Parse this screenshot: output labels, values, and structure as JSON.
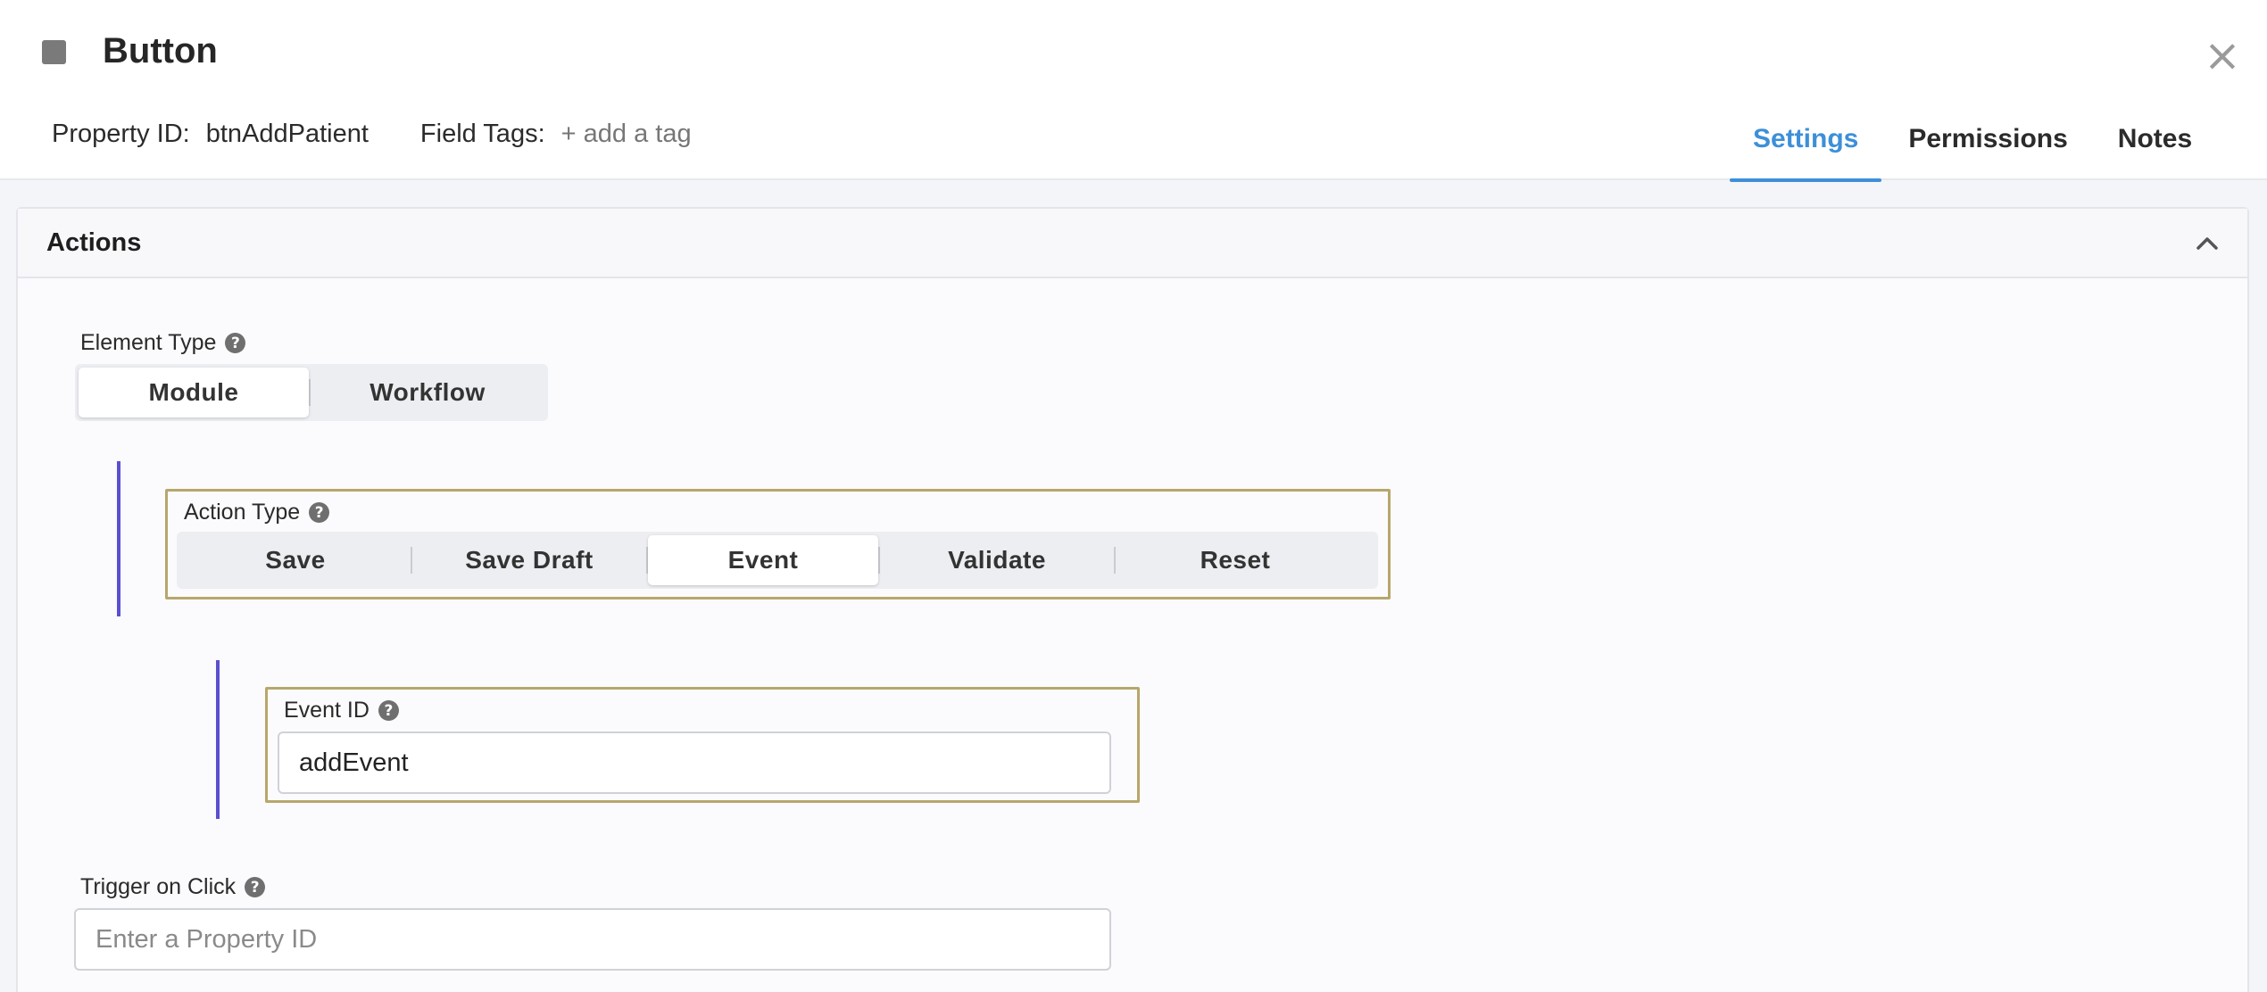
{
  "header": {
    "title": "Button",
    "type_icon": "square-icon",
    "close_icon": "close-icon",
    "close_glyph": "×",
    "property_id_label": "Property ID:",
    "property_id_value": "btnAddPatient",
    "field_tags_label": "Field Tags:",
    "add_tag_label": "+ add a tag",
    "tabs": [
      {
        "label": "Settings",
        "active": true
      },
      {
        "label": "Permissions",
        "active": false
      },
      {
        "label": "Notes",
        "active": false
      }
    ],
    "accent_color": "#3d8fd8"
  },
  "actions": {
    "title": "Actions",
    "collapse_icon": "chevron-up-icon",
    "element_type": {
      "label": "Element Type",
      "options": [
        "Module",
        "Workflow"
      ],
      "selected": "Module"
    },
    "action_type": {
      "label": "Action Type",
      "options": [
        "Save",
        "Save Draft",
        "Event",
        "Validate",
        "Reset"
      ],
      "selected": "Event"
    },
    "event_id": {
      "label": "Event ID",
      "value": "addEvent"
    },
    "trigger_on_click": {
      "label": "Trigger on Click",
      "placeholder": "Enter a Property ID",
      "value": ""
    },
    "help_icon": "question-circle-icon",
    "help_glyph": "?",
    "nesting_bar_color": "#5b4fd1",
    "highlight_border_color": "#b6a76b"
  }
}
